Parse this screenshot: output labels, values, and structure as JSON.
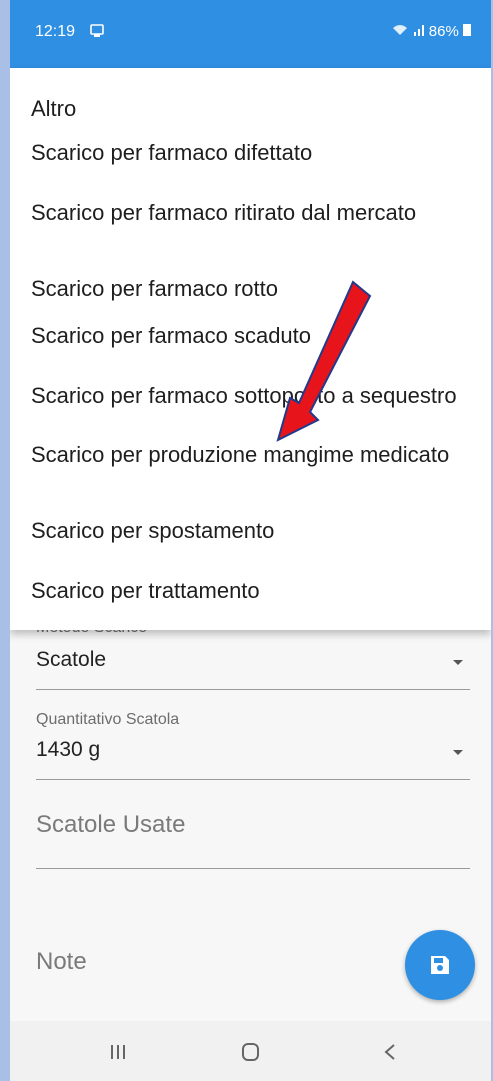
{
  "status": {
    "time": "12:19",
    "battery": "86%"
  },
  "menu": {
    "items": [
      "Altro",
      "Scarico per farmaco difettato",
      "Scarico per farmaco ritirato dal mercato",
      "Scarico per farmaco rotto",
      "Scarico per farmaco scaduto",
      "Scarico per farmaco sottoposto a sequestro",
      "Scarico per produzione mangime medicato",
      "Scarico per spostamento",
      "Scarico per trattamento"
    ]
  },
  "form": {
    "metodo_label": "Metodo Scarico",
    "metodo_value": "Scatole",
    "quantitativo_label": "Quantitativo Scatola",
    "quantitativo_value": "1430 g",
    "scatole_usate_placeholder": "Scatole Usate",
    "note_placeholder": "Note"
  },
  "colors": {
    "accent": "#2f8fe3",
    "annotation_arrow": "#e8141b"
  },
  "icons": {
    "fab": "save-icon",
    "nav_recents": "recents-icon",
    "nav_home": "home-icon",
    "nav_back": "back-icon"
  }
}
